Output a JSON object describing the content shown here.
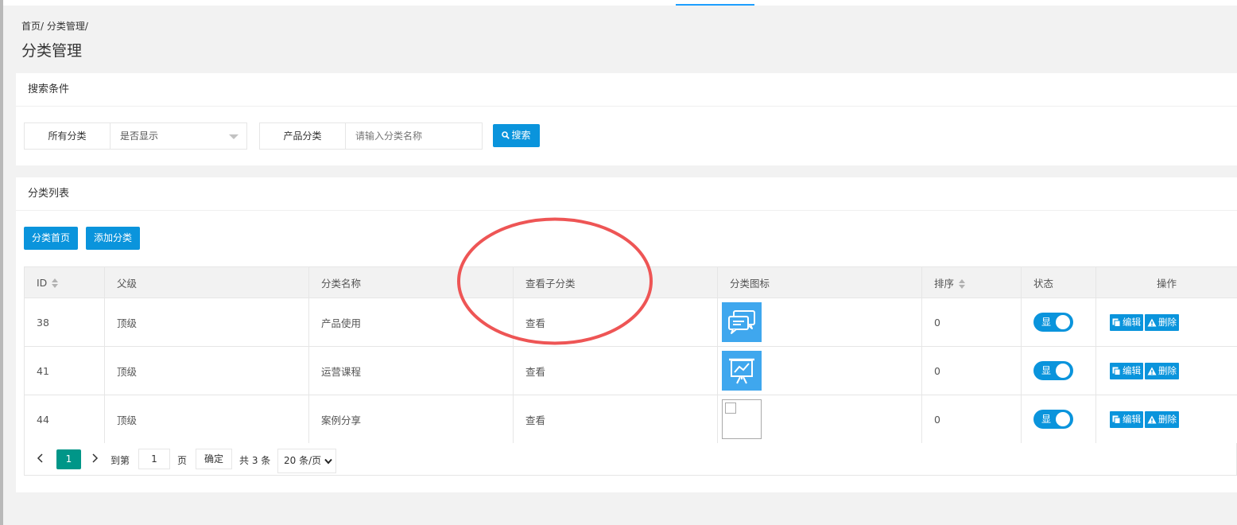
{
  "breadcrumb": "首页/ 分类管理/",
  "page_title": "分类管理",
  "search": {
    "header": "搜索条件",
    "filter_label": "所有分类",
    "filter_value": "是否显示",
    "product_label": "产品分类",
    "product_placeholder": "请输入分类名称",
    "search_button": "搜索"
  },
  "list": {
    "header": "分类列表",
    "home_button": "分类首页",
    "add_button": "添加分类",
    "columns": [
      "ID",
      "父级",
      "分类名称",
      "查看子分类",
      "分类图标",
      "排序",
      "状态",
      "操作"
    ],
    "rows": [
      {
        "id": "38",
        "parent": "顶级",
        "name": "产品使用",
        "view": "查看",
        "icon": "chat-bubbles",
        "sort": "0",
        "status": "显",
        "edit": "编辑",
        "delete": "删除"
      },
      {
        "id": "41",
        "parent": "顶级",
        "name": "运营课程",
        "view": "查看",
        "icon": "presentation-chart",
        "sort": "0",
        "status": "显",
        "edit": "编辑",
        "delete": "删除"
      },
      {
        "id": "44",
        "parent": "顶级",
        "name": "案例分享",
        "view": "查看",
        "icon": "broken-image",
        "sort": "0",
        "status": "显",
        "edit": "编辑",
        "delete": "删除"
      }
    ]
  },
  "pager": {
    "current_page": "1",
    "goto_label": "到第",
    "goto_value": "1",
    "page_unit": "页",
    "confirm_button": "确定",
    "total_text": "共 3 条",
    "page_size": "20 条/页"
  },
  "colors": {
    "primary": "#0a94dc",
    "pager_active": "#009688",
    "icon_bg": "#3fa7ee",
    "annotation": "#ee5555"
  }
}
